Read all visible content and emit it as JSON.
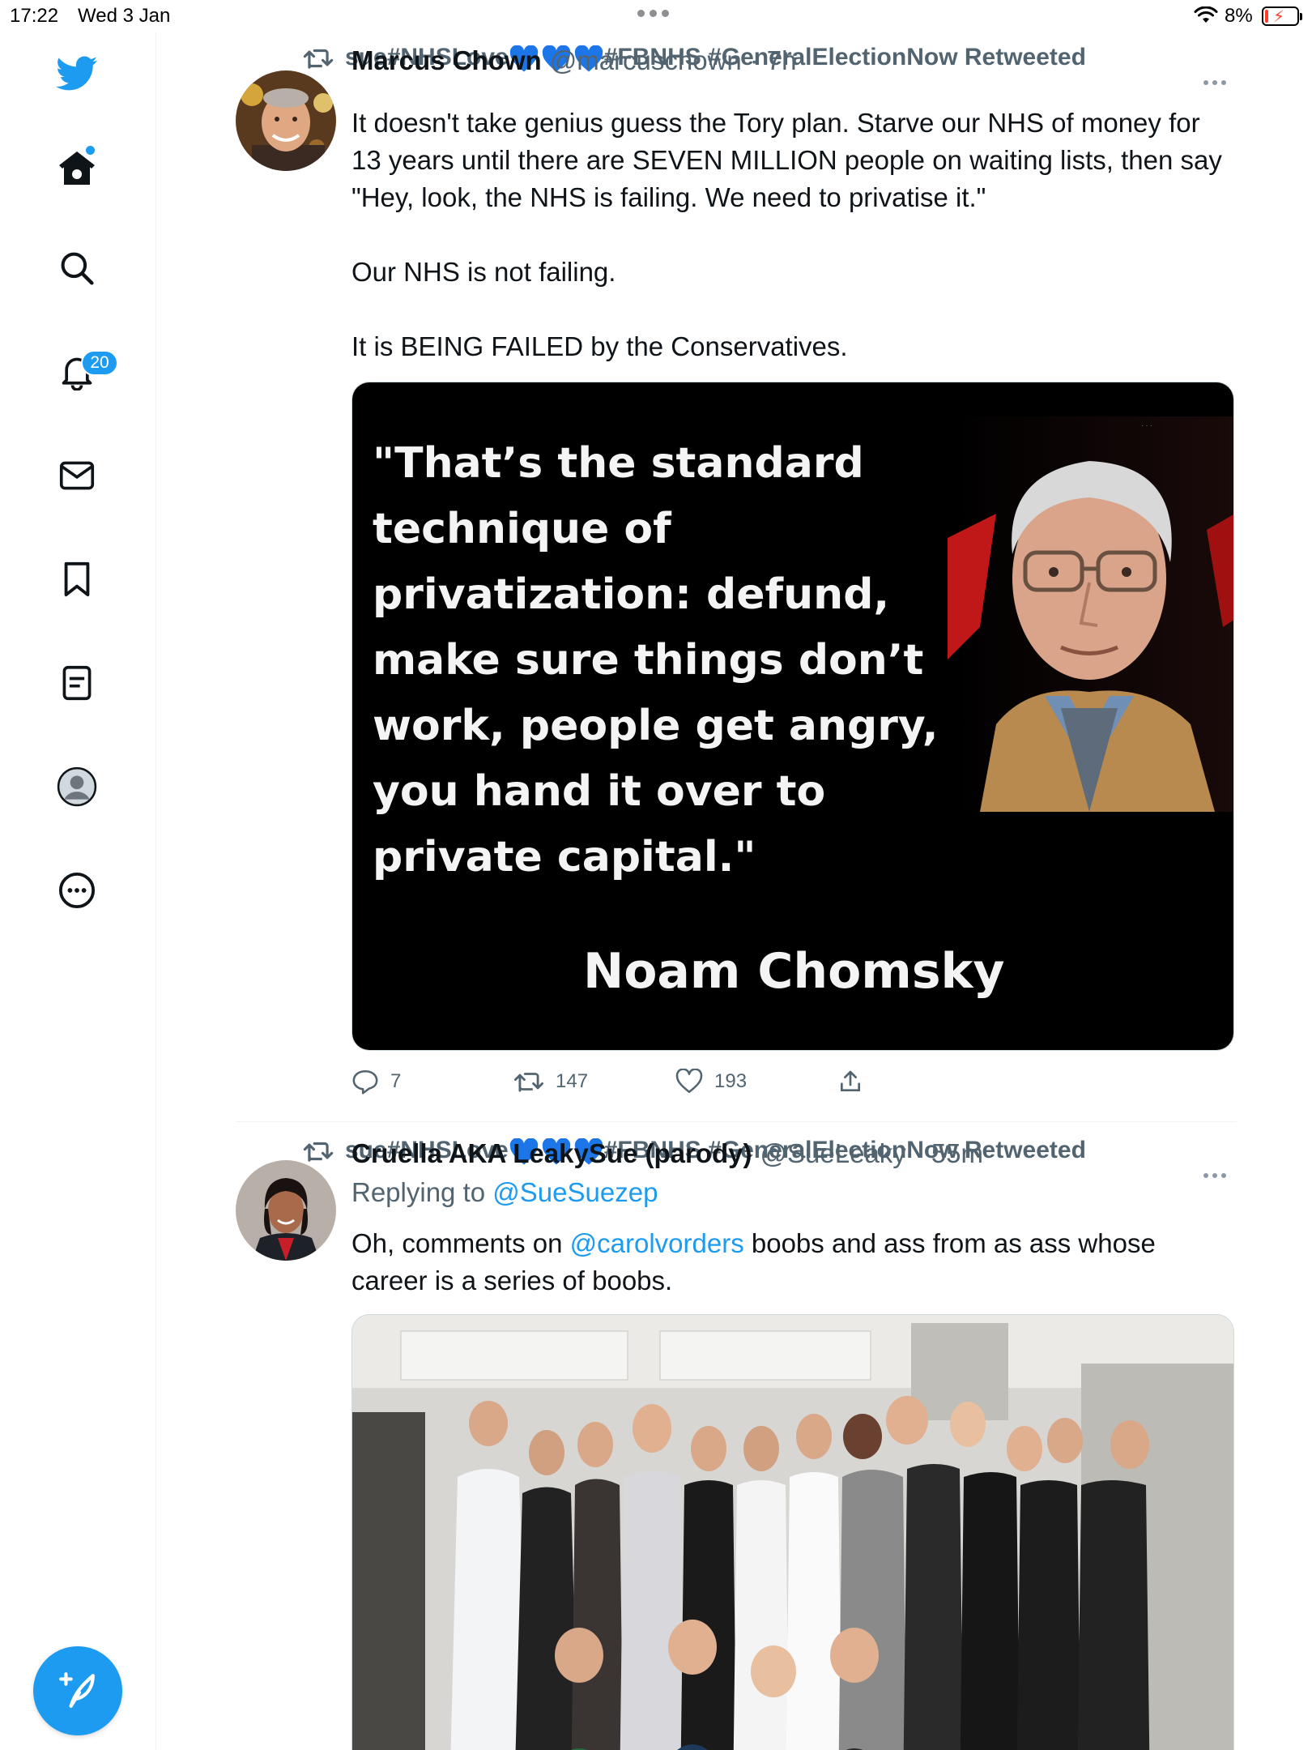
{
  "status_bar": {
    "time": "17:22",
    "date": "Wed 3 Jan",
    "battery": "8%"
  },
  "sidebar": {
    "notifications_badge": "20",
    "items": [
      "twitter-logo",
      "home-icon",
      "search-icon",
      "bell-icon",
      "mail-icon",
      "bookmark-icon",
      "lists-icon",
      "profile-icon",
      "more-circle-icon"
    ]
  },
  "tweets": [
    {
      "retweeted_by_prefix": "sue#NHSLove",
      "retweeted_by_suffix": "#FBNHS #GeneralElectionNow Retweeted",
      "name": "Marcus Chown",
      "handle": "@marcuschown",
      "time": "7h",
      "text": [
        "It doesn't take genius guess the Tory plan. Starve our NHS of money for 13 years until there are SEVEN MILLION people on waiting lists, then say \"Hey, look, the NHS is failing. We need to privatise it.\"",
        "Our NHS is not failing.",
        "It is BEING FAILED by the Conservatives."
      ],
      "image": {
        "quote": "\"That’s the standard technique of privatization: defund, make sure things don’t work, people get angry, you hand it over to private capital.\"",
        "author": "Noam Chomsky"
      },
      "replies": "7",
      "retweets": "147",
      "likes": "193"
    },
    {
      "retweeted_by_prefix": "sue#NHSLove",
      "retweeted_by_suffix": "#FBNHS #GeneralElectionNow Retweeted",
      "name": "Cruella AKA LeakySue (parody)",
      "handle": "@SueLeaky",
      "time": "55m",
      "replying_label": "Replying to",
      "replying_to": "@SueSuezep",
      "text_before": "Oh, comments on",
      "mention": "@carolvorders",
      "text_after": "boobs and ass from as ass whose career is a series of boobs."
    }
  ],
  "colors": {
    "accent": "#1d9bf0",
    "secondary_text": "#536471",
    "heart_emoji": "#1d76e8"
  }
}
